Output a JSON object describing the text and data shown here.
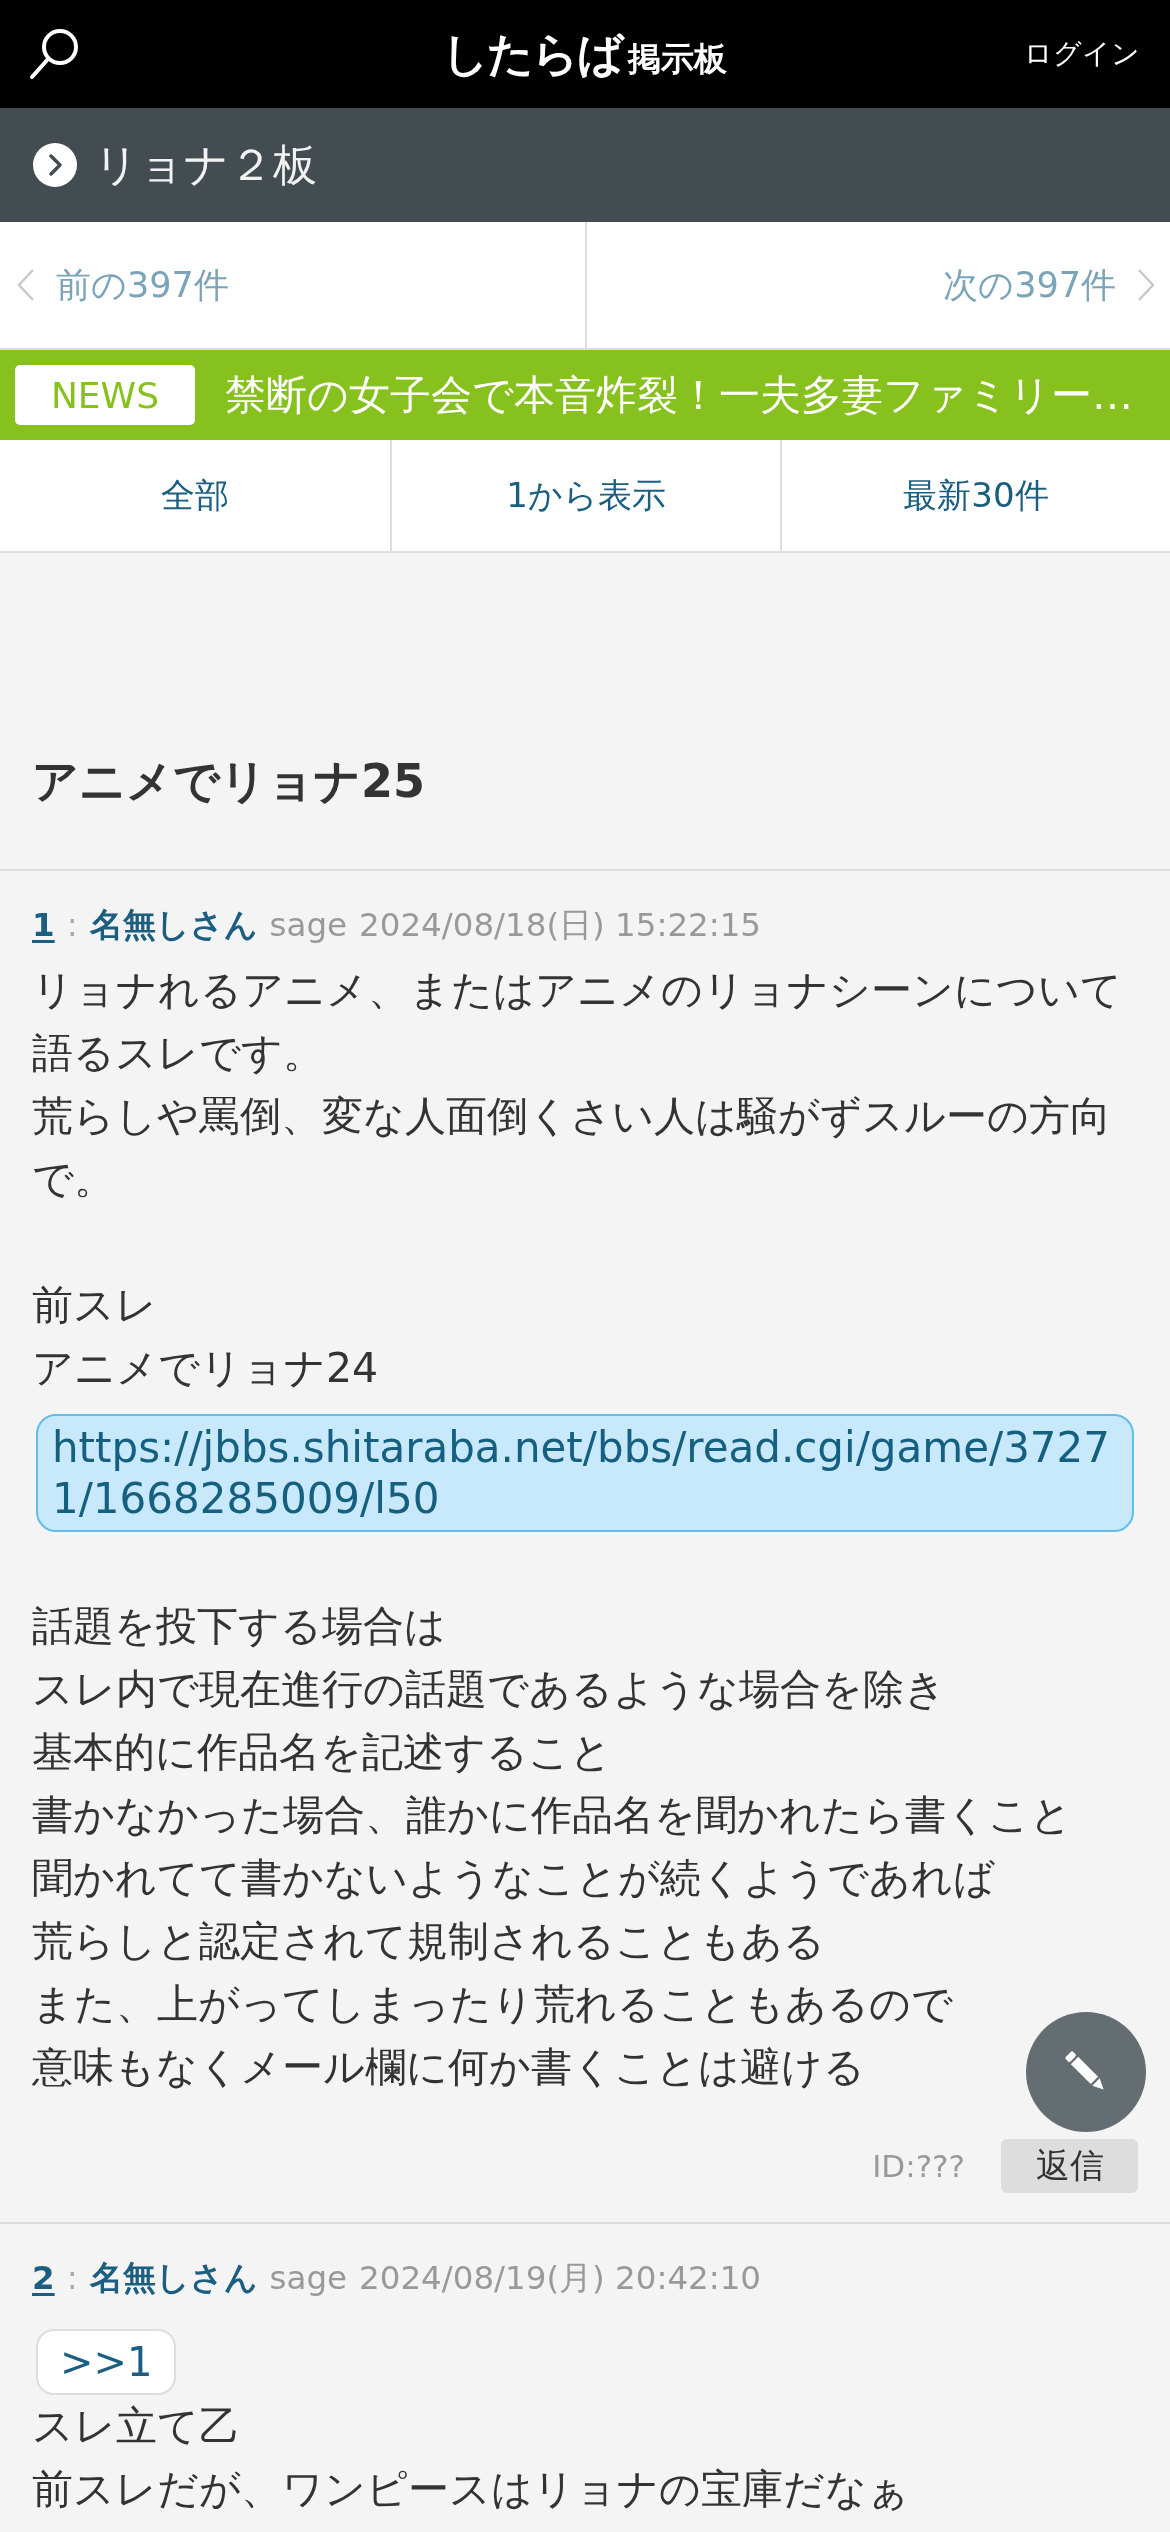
{
  "header": {
    "logo": {
      "main": "したらば",
      "sub": "掲示板"
    },
    "login": "ログイン"
  },
  "board": {
    "title": "リョナ２板"
  },
  "pager": {
    "prev": "前の397件",
    "next": "次の397件"
  },
  "news": {
    "badge": "NEWS",
    "headline": "禁断の女子会で本音炸裂！一夫多妻ファミリー…"
  },
  "view_links": [
    "全部",
    "1から表示",
    "最新30件"
  ],
  "thread": {
    "title": "アニメでリョナ25"
  },
  "posts": [
    {
      "number": "1",
      "separator": ":",
      "name": "名無しさん",
      "mail": "sage",
      "date": "2024/08/18(日) 15:22:15",
      "body": [
        {
          "kind": "text",
          "text": "リョナれるアニメ、またはアニメのリョナシーンについて語るスレです。"
        },
        {
          "kind": "text",
          "text": "荒らしや罵倒、変な人面倒くさい人は騒がずスルーの方向で。"
        },
        {
          "kind": "blank"
        },
        {
          "kind": "text",
          "text": "前スレ"
        },
        {
          "kind": "text",
          "text": "アニメでリョナ24"
        },
        {
          "kind": "link",
          "text": "https://jbbs.shitaraba.net/bbs/read.cgi/game/37271/1668285009/l50"
        },
        {
          "kind": "blank"
        },
        {
          "kind": "text",
          "text": "話題を投下する場合は"
        },
        {
          "kind": "text",
          "text": "スレ内で現在進行の話題であるような場合を除き"
        },
        {
          "kind": "text",
          "text": "基本的に作品名を記述すること"
        },
        {
          "kind": "text",
          "text": "書かなかった場合、誰かに作品名を聞かれたら書くこと"
        },
        {
          "kind": "text",
          "text": "聞かれてて書かないようなことが続くようであれば"
        },
        {
          "kind": "text",
          "text": "荒らしと認定されて規制されることもある"
        },
        {
          "kind": "text",
          "text": "また、上がってしまったり荒れることもあるので"
        },
        {
          "kind": "text",
          "text": "意味もなくメール欄に何か書くことは避ける"
        }
      ],
      "footer": {
        "id": "ID:???",
        "reply": "返信"
      }
    },
    {
      "number": "2",
      "separator": ":",
      "name": "名無しさん",
      "mail": "sage",
      "date": "2024/08/19(月) 20:42:10",
      "body": [
        {
          "kind": "anchor",
          "text": ">>1"
        },
        {
          "kind": "text",
          "text": "スレ立て乙"
        },
        {
          "kind": "text",
          "text": "前スレだが、ワンピースはリョナの宝庫だなぁ"
        }
      ]
    }
  ]
}
